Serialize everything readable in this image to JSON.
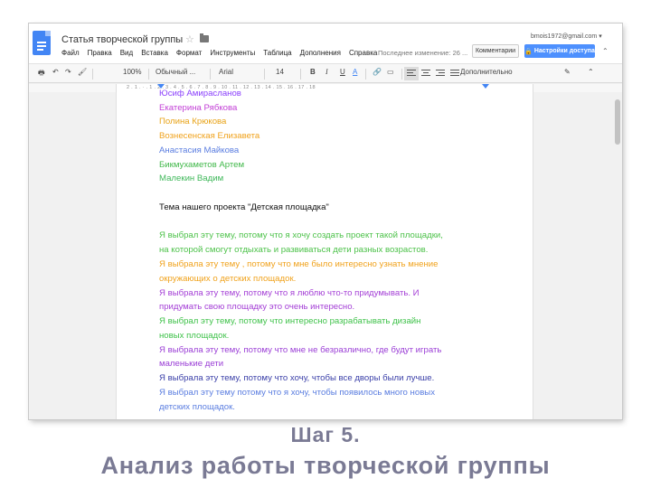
{
  "window": {
    "doc_title": "Статья творческой группы",
    "account": "bmois1972@gmail.com ▾",
    "comments_label": "Комментарии",
    "share_label": "Настройки доступа",
    "last_edit": "Последнее изменение: 26 ..."
  },
  "menu": [
    "Файл",
    "Правка",
    "Вид",
    "Вставка",
    "Формат",
    "Инструменты",
    "Таблица",
    "Дополнения",
    "Справка"
  ],
  "toolbar": {
    "zoom": "100%",
    "style": "Обычный ...",
    "font": "Arial",
    "size": "14",
    "bold": "B",
    "italic": "I",
    "underline": "U",
    "text_color": "A",
    "more": "Дополнительно",
    "ruler_numbers": "2  .  1  .  ·  .  1  .  2  .  3  .  4  .  5  .  6  .  7  .  8  .  9  .  10  .  11  .  12  .  13  .  14  .  15  .  16  .  17  .  18"
  },
  "document": {
    "names": [
      {
        "text": "Юсиф Амирасланов",
        "color": "#8a3ffc"
      },
      {
        "text": "Екатерина Рябкова",
        "color": "#c23fd6"
      },
      {
        "text": "Полина Крюкова",
        "color": "#e8a317"
      },
      {
        "text": "Вознесенская Елизавета",
        "color": "#f0a21c"
      },
      {
        "text": "Анастасия Майкова",
        "color": "#5a7de0"
      },
      {
        "text": "Бикмухаметов Артем",
        "color": "#41b84a"
      },
      {
        "text": "Малекин Вадим",
        "color": "#3fb85a"
      }
    ],
    "topic": "Тема нашего проекта \"Детская площадка\"",
    "reasons": [
      {
        "text": "Я выбрал эту тему, потому что я хочу создать проект такой площадки,",
        "color": "#4dc24a"
      },
      {
        "text": "на которой смогут отдыхать и развиваться дети разных возрастов.",
        "color": "#4dc24a"
      },
      {
        "text": "Я выбрала эту тему , потому что мне было интересно узнать мнение",
        "color": "#f0a21c"
      },
      {
        "text": "окружающих о детских площадок.",
        "color": "#f0a21c"
      },
      {
        "text": "Я выбрала эту тему, потому что я люблю что-то придумывать. И",
        "color": "#a43fd6"
      },
      {
        "text": "придумать свою площадку это очень интересно.",
        "color": "#a43fd6"
      },
      {
        "text": "Я выбрал эту тему, потому что интересно разрабатывать дизайн",
        "color": "#3fc24a"
      },
      {
        "text": "новых площадок.",
        "color": "#3fc24a"
      },
      {
        "text": "Я выбрала эту тему, потому что мне не безразлично, где будут играть",
        "color": "#9b3fd6"
      },
      {
        "text": "маленькие дети",
        "color": "#9b3fd6"
      },
      {
        "text": "Я выбрала эту тему, потому что хочу, чтобы все дворы были лучше.",
        "color": "#3a3fa8"
      },
      {
        "text": "Я выбрал эту тему потому что я хочу, чтобы появилось много новых",
        "color": "#5a7de0"
      },
      {
        "text": "детских площадок.",
        "color": "#5a7de0"
      }
    ]
  },
  "slide": {
    "title_line1": "Шаг 5.",
    "title_line2": "Анализ работы творческой группы"
  }
}
